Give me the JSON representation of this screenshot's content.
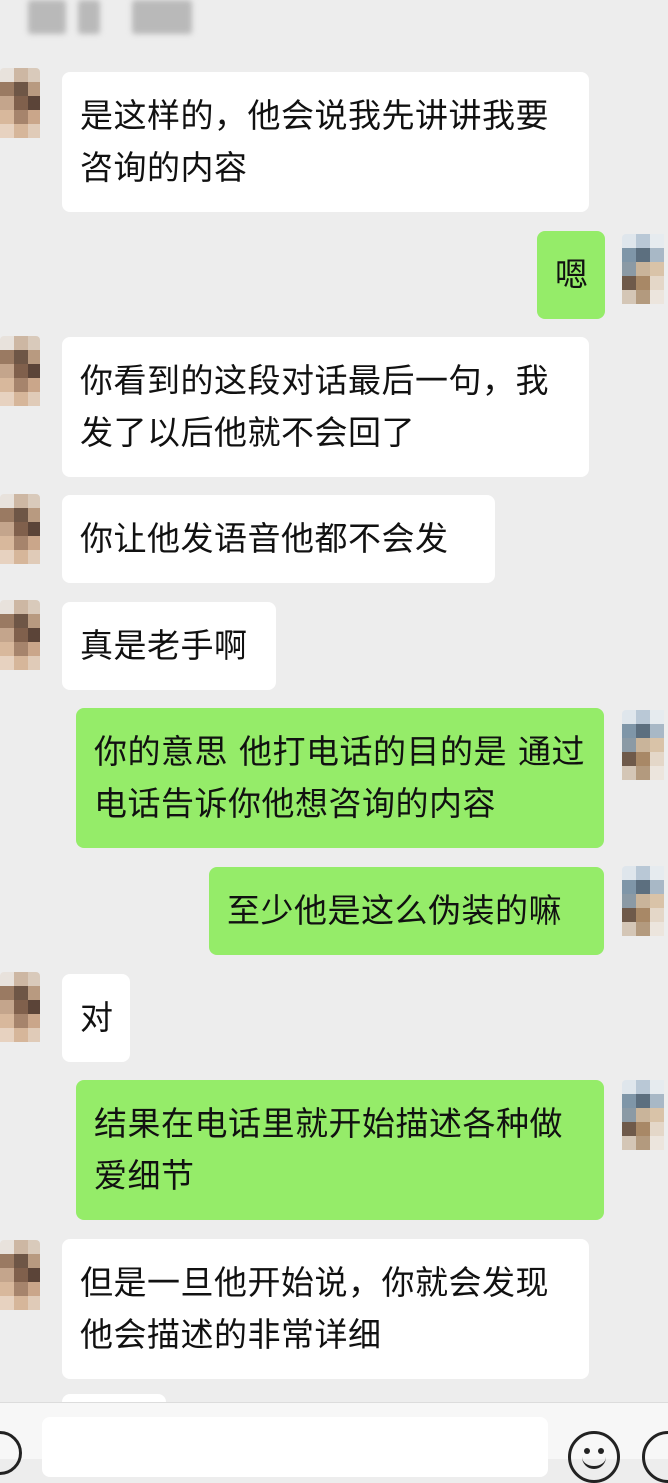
{
  "status_bar": {
    "time_blurred": true
  },
  "messages": [
    {
      "id": "m1",
      "side": "in",
      "text": "是这样的，他会说我先讲讲我要咨询的内容"
    },
    {
      "id": "m2",
      "side": "out",
      "text": "嗯"
    },
    {
      "id": "m3",
      "side": "in",
      "text": "你看到的这段对话最后一句，我发了以后他就不会回了"
    },
    {
      "id": "m4",
      "side": "in",
      "text": "你让他发语音他都不会发"
    },
    {
      "id": "m5",
      "side": "in",
      "text": "真是老手啊"
    },
    {
      "id": "m6",
      "side": "out",
      "text": "你的意思 他打电话的目的是 通过电话告诉你他想咨询的内容"
    },
    {
      "id": "m7",
      "side": "out",
      "text": "至少他是这么伪装的嘛"
    },
    {
      "id": "m8",
      "side": "in",
      "text": "对"
    },
    {
      "id": "m9",
      "side": "out",
      "text": "结果在电话里就开始描述各种做爱细节"
    },
    {
      "id": "m10",
      "side": "in",
      "text": "但是一旦他开始说，你就会发现他会描述的非常详细"
    }
  ],
  "input_bar": {
    "voice_icon": "voice-icon",
    "emoji_icon": "emoji-icon",
    "plus_icon": "plus-icon",
    "input_value": ""
  },
  "colors": {
    "background": "#ededed",
    "incoming_bubble": "#ffffff",
    "outgoing_bubble": "#95ec69"
  }
}
